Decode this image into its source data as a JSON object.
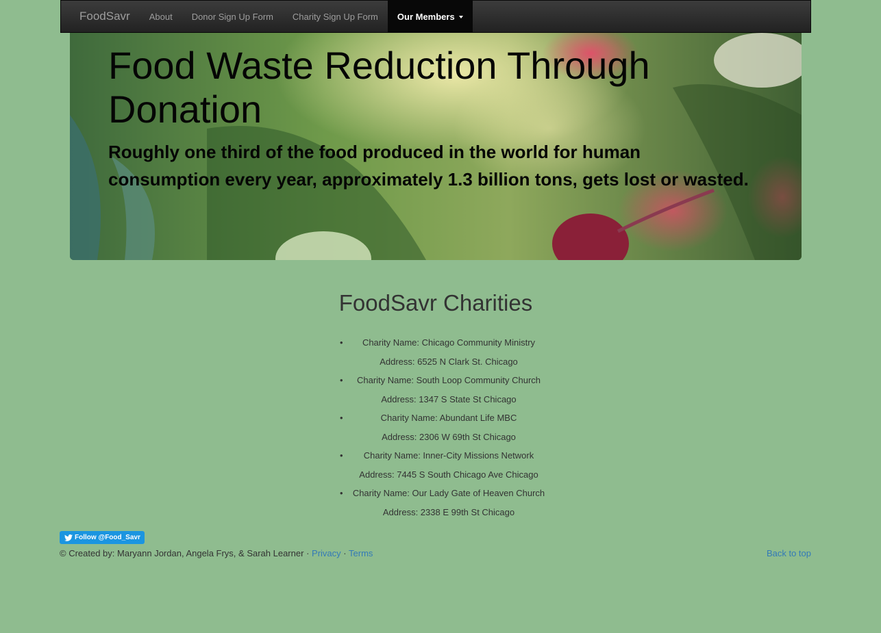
{
  "navbar": {
    "brand": "FoodSavr",
    "links": [
      "About",
      "Donor Sign Up Form",
      "Charity Sign Up Form"
    ],
    "dropdown_label": "Our Members"
  },
  "hero": {
    "title": "Food Waste Reduction Through Donation",
    "subtitle": "Roughly one third of the food produced in the world for human consumption every year, approximately 1.3 billion tons, gets lost or wasted."
  },
  "charities": {
    "title": "FoodSavr Charities",
    "items": [
      {
        "name": "Charity Name: Chicago Community Ministry",
        "address": "Address: 6525 N Clark St. Chicago"
      },
      {
        "name": "Charity Name: South Loop Community Church",
        "address": "Address: 1347 S State St Chicago"
      },
      {
        "name": "Charity Name: Abundant Life MBC",
        "address": "Address: 2306 W 69th St Chicago"
      },
      {
        "name": "Charity Name: Inner-City Missions Network",
        "address": "Address: 7445 S South Chicago Ave Chicago"
      },
      {
        "name": "Charity Name: Our Lady Gate of Heaven Church",
        "address": "Address: 2338 E 99th St Chicago"
      }
    ]
  },
  "footer": {
    "follow_label": "Follow @Food_Savr",
    "credits": "© Created by: Maryann Jordan, Angela Frys, & Sarah Learner",
    "separator": "·",
    "privacy": "Privacy",
    "terms": "Terms",
    "back_to_top": "Back to top"
  },
  "colors": {
    "page_bg": "#8fbc8f",
    "navbar_bg": "#222222",
    "link": "#337ab7",
    "twitter": "#1b95e0"
  }
}
